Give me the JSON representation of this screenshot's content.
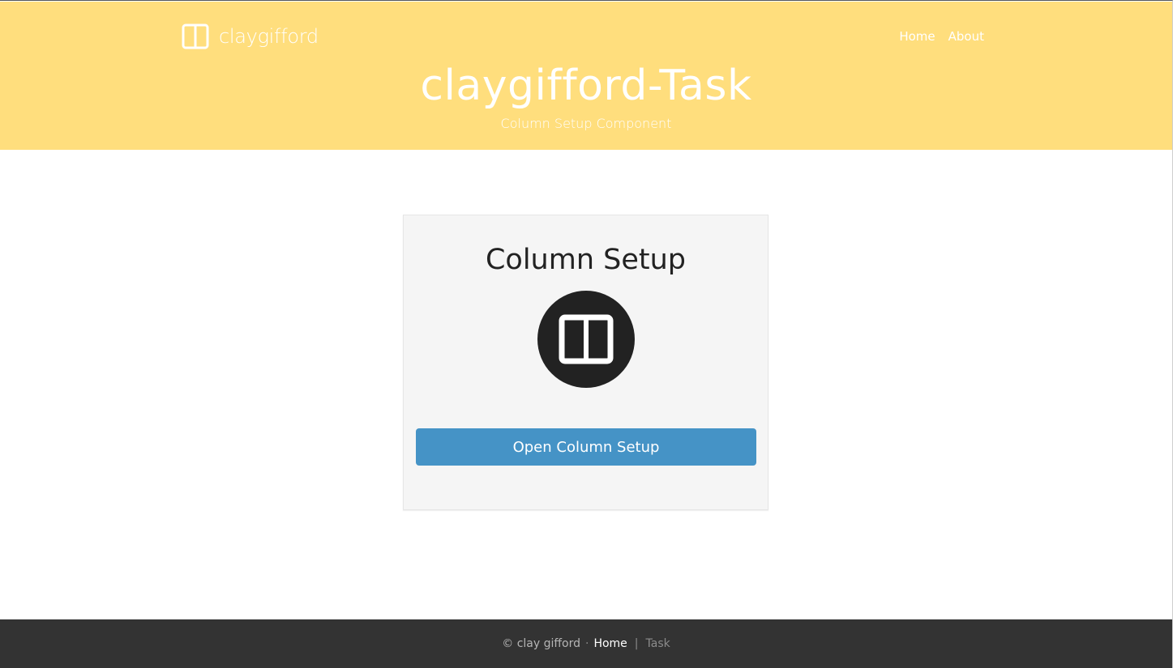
{
  "header": {
    "brand": {
      "icon": "columns-icon",
      "text": "claygifford"
    },
    "nav": [
      {
        "label": "Home"
      },
      {
        "label": "About"
      }
    ],
    "title": "claygifford-Task",
    "subtitle": "Column Setup Component",
    "background_color": "#ffde7d"
  },
  "card": {
    "title": "Column Setup",
    "icon": "columns-icon",
    "button_label": "Open Column Setup",
    "button_color": "#4593c6"
  },
  "footer": {
    "copyright": "© clay gifford",
    "separator_dot": "·",
    "home_label": "Home",
    "separator_bar": "|",
    "current_label": "Task",
    "background_color": "#333333"
  }
}
